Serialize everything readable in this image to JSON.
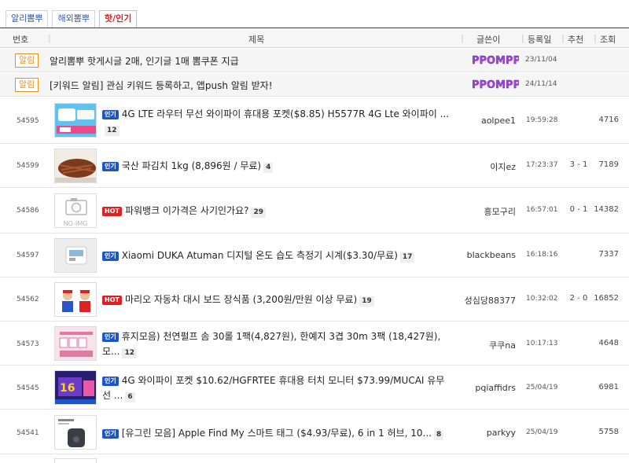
{
  "tabs": [
    {
      "label": "알리뽐뿌",
      "active": false
    },
    {
      "label": "해외뽐뿌",
      "active": false
    },
    {
      "label": "핫/인기",
      "active": true
    }
  ],
  "header": {
    "num": "번호",
    "title": "제목",
    "author": "글쓴이",
    "date": "등록일",
    "rec": "추천",
    "views": "조회"
  },
  "notices": [
    {
      "badge": "알림",
      "title": "알리뽐뿌 핫게시글 2매, 인기글 1매 뽐쿠폰 지급",
      "date": "23/11/04"
    },
    {
      "badge": "알림",
      "title": "[키워드 알림] 관심 키워드 등록하고, 앱push 알림 받자!",
      "date": "24/11/14"
    }
  ],
  "posts": [
    {
      "num": "54595",
      "badge": "인기",
      "title": "4G LTE 라우터 무선 와이파이 휴대용 포켓($8.85) H5577R 4G Lte 와이파이 ...",
      "comments": "12",
      "author": "aolpee1",
      "time": "19:59:28",
      "rec": "",
      "views": "4716"
    },
    {
      "num": "54599",
      "badge": "인기",
      "title": "국산 파김치 1kg (8,896원 / 무료)",
      "comments": "4",
      "author": "이지ez",
      "time": "17:23:37",
      "rec": "3 - 1",
      "views": "7189"
    },
    {
      "num": "54586",
      "badge": "HOT",
      "title": "파워뱅크 이가격은 사기인가요?",
      "comments": "29",
      "author": "흥모구리",
      "time": "16:57:01",
      "rec": "0 - 1",
      "views": "14382"
    },
    {
      "num": "54597",
      "badge": "인기",
      "title": "Xiaomi DUKA Atuman 디지털 온도 습도 측정기 시계($3.30/무료)",
      "comments": "17",
      "author": "blackbeans",
      "time": "16:18:16",
      "rec": "",
      "views": "7337"
    },
    {
      "num": "54562",
      "badge": "HOT",
      "title": "마리오 자동차 대시 보드 장식품 (3,200원/만원 이상 무료)",
      "comments": "19",
      "author": "성심당88377",
      "time": "10:32:02",
      "rec": "2 - 0",
      "views": "16852"
    },
    {
      "num": "54573",
      "badge": "인기",
      "title": "휴지모음) 천연펄프 솜 30롤 1팩(4,827원), 한예지 3겹 30m 3팩 (18,427원), 모...",
      "comments": "12",
      "author": "쿠쿠na",
      "time": "10:17:13",
      "rec": "",
      "views": "4648"
    },
    {
      "num": "54545",
      "badge": "인기",
      "title": "4G 와이파이 포켓 $10.62/HGFRTEE 휴대용 터치 모니터 $73.99/MUCAI 유무선 ...",
      "comments": "6",
      "author": "pqiaffidrs",
      "time": "25/04/19",
      "rec": "",
      "views": "6981"
    },
    {
      "num": "54541",
      "badge": "인기",
      "title": "[유그린 모음] Apple Find My 스마트 태그 ($4.93/무료), 6 in 1 허브, 10...",
      "comments": "8",
      "author": "parkyy",
      "time": "25/04/19",
      "rec": "",
      "views": "5758"
    }
  ],
  "thumb_placeholder": "NO-IMG",
  "colors": {
    "accent_blue": "#1a56c8",
    "hot_red": "#e02020",
    "notice_orange": "#e8901c",
    "tab_active_red": "#e02020"
  }
}
